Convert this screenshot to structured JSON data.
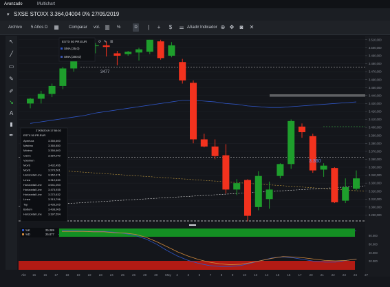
{
  "tabs": [
    "Avanzado",
    "Multichart"
  ],
  "title": "SXSE STOXX 3.364,04004 0% 27/05/2019",
  "toolbar": {
    "archive": "Archivo",
    "period": "5 Años D",
    "compare": "Comparar",
    "vol": "vol.",
    "percent": "%",
    "draw_d": "D",
    "add_indicator": "Añadir Indicador"
  },
  "icons": {
    "tools": [
      "cursor-icon",
      "crosshair-icon",
      "rectangle-icon",
      "pencil-icon",
      "brush-icon",
      "trend-icon",
      "text-icon",
      "trash-icon",
      "eyedropper-icon"
    ],
    "toolbar": [
      "grid-icon",
      "chart-type-icon",
      "line-icon",
      "plus-icon",
      "dollar-icon",
      "sliders-icon",
      "zoom-icon",
      "pan-icon",
      "camera-icon",
      "close-icon"
    ]
  },
  "legend_box": {
    "symbol": "ESTX 50 PR.EUR",
    "sma1": "SMA (35,0)",
    "sma2": "SMA (200,0)"
  },
  "info_panel": {
    "datetime": "27/05/2019 17:50:02",
    "symbol": "ESTX 50 PR.EUR",
    "rows": [
      {
        "label": "Apertura",
        "value": "3.350,600"
      },
      {
        "label": "Máximo",
        "value": "3.360,850"
      },
      {
        "label": "Mínimo",
        "value": "3.350,600"
      },
      {
        "label": "Cierre",
        "value": "3.364,040"
      },
      {
        "label": "Volumen",
        "value": ""
      },
      {
        "label": "MovS",
        "value": "3.432,456"
      },
      {
        "label": "MovS",
        "value": "3.270,501"
      },
      {
        "label": "Horizontal Line",
        "value": "3.362,371"
      },
      {
        "label": "Línea",
        "value": "3.312,630"
      },
      {
        "label": "Horizontal Line",
        "value": "3.541,053"
      },
      {
        "label": "Horizontal Line",
        "value": "3.475,935"
      },
      {
        "label": "Horizontal Line",
        "value": "3.272,632"
      },
      {
        "label": "Línea",
        "value": "3.313,796"
      },
      {
        "label": "Top",
        "value": "3.435,205"
      },
      {
        "label": "Bottom",
        "value": "3.438,006"
      },
      {
        "label": "Horizontal Line",
        "value": "3.397,554"
      }
    ]
  },
  "annotations": {
    "left": "3477",
    "right": "3.360"
  },
  "ind_legend": [
    {
      "label": "%K",
      "value": "25.289"
    },
    {
      "label": "%D",
      "value": "25.877"
    }
  ],
  "colors": {
    "up": "#1e9e2c",
    "down": "#f2321e",
    "sma_blue": "#2f56c8",
    "panel_green": "#148f23",
    "panel_red": "#b21b14"
  },
  "chart_data": {
    "type": "candlestick",
    "symbol": "ESTX 50 PR.EUR",
    "price_ticks": [
      "3.510,000",
      "3.500,000",
      "3.490,000",
      "3.480,000",
      "3.470,000",
      "3.460,000",
      "3.450,000",
      "3.440,000",
      "3.430,000",
      "3.420,000",
      "3.410,000",
      "3.400,000",
      "3.390,000",
      "3.380,000",
      "3.370,000",
      "3.360,000",
      "3.350,000",
      "3.340,000",
      "3.330,000",
      "3.320,000",
      "3.310,000",
      "3.300,000",
      "3.290,000"
    ],
    "ylim": [
      3280,
      3515
    ],
    "x_ticks": [
      "Abr",
      "15",
      "16",
      "17",
      "18",
      "19",
      "22",
      "23",
      "24",
      "25",
      "26",
      "29",
      "30",
      "May",
      "2",
      "3",
      "6",
      "7",
      "8",
      "9",
      "10",
      "13",
      "14",
      "15",
      "16",
      "17",
      "20",
      "21",
      "22",
      "23",
      "24",
      "27"
    ],
    "candles": [
      {
        "o": 3430,
        "h": 3437,
        "l": 3424,
        "c": 3436
      },
      {
        "o": 3436,
        "h": 3446,
        "l": 3430,
        "c": 3442
      },
      {
        "o": 3442,
        "h": 3455,
        "l": 3438,
        "c": 3452
      },
      {
        "o": 3452,
        "h": 3476,
        "l": 3448,
        "c": 3474
      },
      {
        "o": 3474,
        "h": 3490,
        "l": 3470,
        "c": 3488
      },
      {
        "o": 3488,
        "h": 3506,
        "l": 3485,
        "c": 3503
      },
      {
        "o": 3503,
        "h": 3506,
        "l": 3493,
        "c": 3503
      },
      {
        "o": 3503,
        "h": 3508,
        "l": 3489,
        "c": 3501
      },
      {
        "o": 3493,
        "h": 3496,
        "l": 3478,
        "c": 3490
      },
      {
        "o": 3492,
        "h": 3496,
        "l": 3490,
        "c": 3495
      },
      {
        "o": 3494,
        "h": 3500,
        "l": 3484,
        "c": 3498
      },
      {
        "o": 3495,
        "h": 3510,
        "l": 3492,
        "c": 3510
      },
      {
        "o": 3508,
        "h": 3510,
        "l": 3485,
        "c": 3487
      },
      {
        "o": 3490,
        "h": 3507,
        "l": 3488,
        "c": 3503
      },
      {
        "o": 3482,
        "h": 3486,
        "l": 3455,
        "c": 3459
      },
      {
        "o": 3456,
        "h": 3459,
        "l": 3380,
        "c": 3385
      },
      {
        "o": 3385,
        "h": 3392,
        "l": 3375,
        "c": 3376
      },
      {
        "o": 3376,
        "h": 3385,
        "l": 3360,
        "c": 3364
      },
      {
        "o": 3365,
        "h": 3379,
        "l": 3317,
        "c": 3322
      },
      {
        "o": 3322,
        "h": 3335,
        "l": 3315,
        "c": 3330
      },
      {
        "o": 3334,
        "h": 3335,
        "l": 3282,
        "c": 3289
      },
      {
        "o": 3300,
        "h": 3345,
        "l": 3296,
        "c": 3339
      },
      {
        "o": 3310,
        "h": 3332,
        "l": 3298,
        "c": 3322
      },
      {
        "o": 3339,
        "h": 3355,
        "l": 3336,
        "c": 3354
      },
      {
        "o": 3354,
        "h": 3410,
        "l": 3348,
        "c": 3408
      },
      {
        "o": 3401,
        "h": 3405,
        "l": 3387,
        "c": 3394
      },
      {
        "o": 3389,
        "h": 3392,
        "l": 3343,
        "c": 3346
      },
      {
        "o": 3347,
        "h": 3355,
        "l": 3338,
        "c": 3352
      },
      {
        "o": 3349,
        "h": 3350,
        "l": 3305,
        "c": 3306
      },
      {
        "o": 3308,
        "h": 3336,
        "l": 3305,
        "c": 3325
      },
      {
        "o": 3323,
        "h": 3346,
        "l": 3321,
        "c": 3336
      }
    ],
    "sma_35": [
      3405,
      3407,
      3409,
      3411,
      3413,
      3415,
      3418,
      3420,
      3422,
      3424,
      3426,
      3428,
      3430,
      3432,
      3434,
      3434,
      3433,
      3432,
      3430,
      3429,
      3427,
      3426,
      3425,
      3425,
      3426,
      3427,
      3428,
      3429,
      3430,
      3431,
      3432
    ],
    "sma_200": [
      3263,
      3264,
      3265,
      3266,
      3267,
      3268,
      3268,
      3269,
      3269,
      3270,
      3270,
      3270,
      3270,
      3270,
      3270,
      3270,
      3270,
      3270,
      3270,
      3270,
      3270,
      3270,
      3270,
      3270,
      3270,
      3270,
      3270,
      3270,
      3270,
      3270,
      3270
    ],
    "horizontal_lines": [
      3475.9,
      3362.4,
      3313.8
    ],
    "stochastic": {
      "ticks": [
        "80.000",
        "60.000",
        "40.000",
        "20.000"
      ],
      "ylim": [
        0,
        100
      ],
      "k": [
        92,
        92,
        91,
        90,
        90,
        88,
        85,
        80,
        72,
        60,
        45,
        32,
        22,
        15,
        10,
        8,
        8,
        10,
        16,
        22,
        28,
        30,
        28,
        24,
        20,
        18,
        18,
        22,
        25
      ],
      "d": [
        90,
        90,
        90,
        89,
        89,
        87,
        86,
        83,
        76,
        66,
        54,
        42,
        32,
        24,
        18,
        14,
        12,
        13,
        17,
        22,
        27,
        31,
        30,
        28,
        25,
        22,
        21,
        22,
        25
      ]
    }
  }
}
